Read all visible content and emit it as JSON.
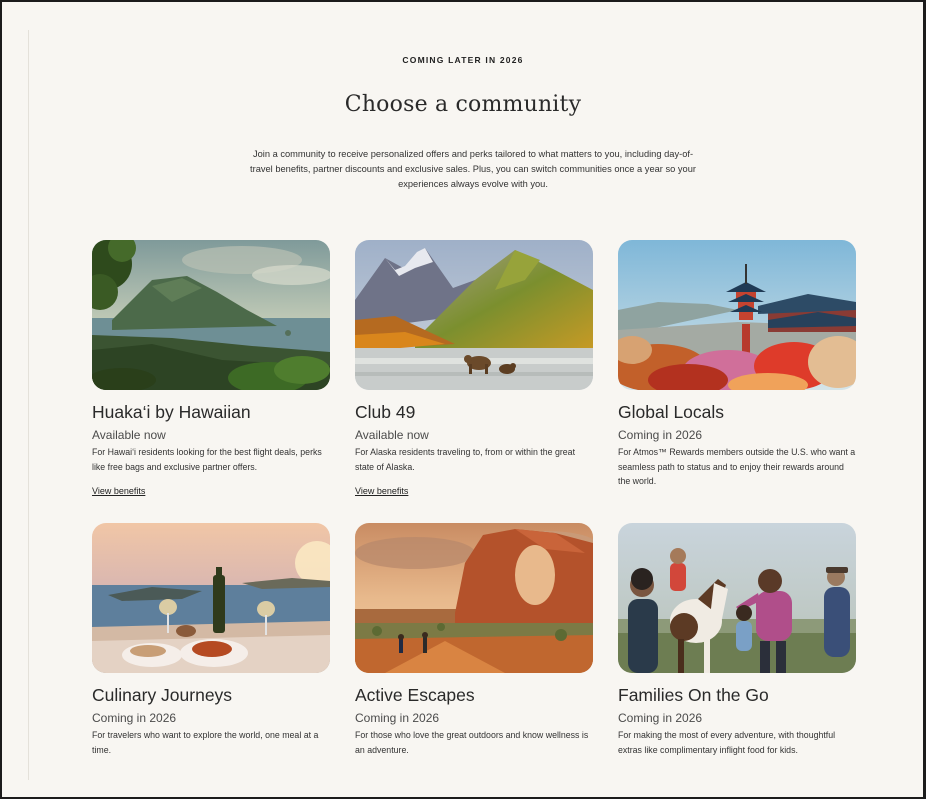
{
  "header": {
    "eyebrow": "COMING LATER IN 2026",
    "title": "Choose a community",
    "intro": "Join a community to receive personalized offers and perks tailored to what matters to you, including day-of-travel benefits, partner discounts and exclusive sales. Plus, you can switch communities once a year so your experiences always evolve with you."
  },
  "cards": [
    {
      "title": "Huaka‘i by Hawaiian",
      "status": "Available now",
      "description": "For Hawai‘i residents looking for the best flight deals, perks like free bags and exclusive partner offers.",
      "link": "View benefits",
      "image": "hawaii-coastline-photo"
    },
    {
      "title": "Club 49",
      "status": "Available now",
      "description": "For Alaska residents traveling to, from or within the great state of Alaska.",
      "link": "View benefits",
      "image": "alaska-bears-photo"
    },
    {
      "title": "Global Locals",
      "status": "Coming in 2026",
      "description": "For Atmos™ Rewards members outside the U.S. who want a seamless path to status and to enjoy their rewards around the world.",
      "image": "japan-pagoda-photo"
    },
    {
      "title": "Culinary Journeys",
      "status": "Coming in 2026",
      "description": "For travelers who want to explore the world, one meal at a time.",
      "image": "seaside-dinner-photo"
    },
    {
      "title": "Active Escapes",
      "status": "Coming in 2026",
      "description": "For those who love the great outdoors and know wellness is an adventure.",
      "image": "desert-arch-photo"
    },
    {
      "title": "Families On the Go",
      "status": "Coming in 2026",
      "description": "For making the most of every adventure, with thoughtful extras like complimentary inflight food for kids.",
      "image": "family-horse-photo"
    }
  ]
}
